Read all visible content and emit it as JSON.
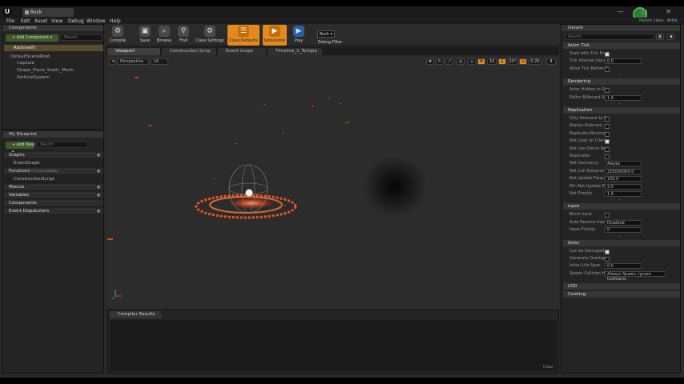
{
  "window": {
    "doc_tab": "Rock",
    "controls": "— ▢ ✕"
  },
  "menu": [
    "File",
    "Edit",
    "Asset",
    "View",
    "Debug",
    "Window",
    "Help"
  ],
  "parent_class": {
    "label": "Parent class:",
    "value": "Actor"
  },
  "components": {
    "title": "Components",
    "add_button": "+ Add Component ▾",
    "search_placeholder": "Search",
    "self_item": "Rock(self)",
    "items": [
      "DefaultSceneRoot",
      "Capsule",
      "Shape_Plane_Static_Mesh",
      "ParticleSystem"
    ]
  },
  "my_blueprint": {
    "title": "My Blueprint",
    "add_new": "+ Add New ▾",
    "search_placeholder": "Search",
    "sections": [
      {
        "label": "Graphs",
        "plus": "+"
      },
      {
        "label": "EventGraph",
        "plus": ""
      },
      {
        "label": "Functions",
        "note": "(4 Overridable)",
        "plus": "+"
      },
      {
        "label": "ConstructionScript",
        "plus": ""
      },
      {
        "label": "Macros",
        "plus": "+"
      },
      {
        "label": "Variables",
        "plus": "+"
      },
      {
        "label": "Components",
        "plus": ""
      },
      {
        "label": "Event Dispatchers",
        "plus": "+"
      }
    ]
  },
  "toolbar": {
    "buttons": [
      "Compile",
      "Save",
      "Browse",
      "Find",
      "Class Settings",
      "Class Defaults",
      "Simulation",
      "Play",
      "Debug Filter"
    ],
    "debug_object": "Rock ▾"
  },
  "doc_tabs": [
    "Viewport",
    "Construction Scrip",
    "Event Graph",
    "Timeline_1_Templa"
  ],
  "viewport": {
    "view_mode": "Perspective",
    "lit_mode": "Lit",
    "grid_snap": "10",
    "rot_snap": "10°",
    "scale_snap": "0.25",
    "cam_speed": "4"
  },
  "compiler": {
    "title": "Compiler Results",
    "clear": "Clear"
  },
  "details": {
    "title": "Details",
    "search_placeholder": "Search",
    "sections": [
      {
        "label": "Actor Tick",
        "props": [
          {
            "name": "Start with Tick Enab",
            "type": "check",
            "on": true
          },
          {
            "name": "Tick Interval (secs)",
            "type": "value",
            "value": "0.0"
          },
          {
            "name": "Allow Tick Before B",
            "type": "check",
            "on": false
          }
        ]
      },
      {
        "label": "Rendering",
        "props": [
          {
            "name": "Actor Hidden In Ga",
            "type": "check",
            "on": false
          },
          {
            "name": "Editor Billboard Sc",
            "type": "value",
            "value": "1.0"
          }
        ]
      },
      {
        "label": "Replication",
        "props": [
          {
            "name": "Only Relevant to O",
            "type": "check",
            "on": false
          },
          {
            "name": "Always Relevant",
            "type": "check",
            "on": false
          },
          {
            "name": "Replicate Moveme",
            "type": "check",
            "on": false
          },
          {
            "name": "Net Load on Client",
            "type": "check",
            "on": true
          },
          {
            "name": "Net Use Owner Rel",
            "type": "check",
            "on": false
          },
          {
            "name": "Replicates",
            "type": "check",
            "on": false
          },
          {
            "name": "Net Dormancy",
            "type": "value",
            "value": "Awake"
          },
          {
            "name": "Net Cull Distance S",
            "type": "value",
            "value": "225000000.0"
          },
          {
            "name": "Net Update Freque",
            "type": "value",
            "value": "100.0"
          },
          {
            "name": "Min Net Update Fr",
            "type": "value",
            "value": "2.0"
          },
          {
            "name": "Net Priority",
            "type": "value",
            "value": "1.0"
          }
        ]
      },
      {
        "label": "Input",
        "props": [
          {
            "name": "Block Input",
            "type": "check",
            "on": false
          },
          {
            "name": "Auto Receive Input",
            "type": "value",
            "value": "Disabled"
          },
          {
            "name": "Input Priority",
            "type": "value",
            "value": "0"
          }
        ]
      },
      {
        "label": "Actor",
        "props": [
          {
            "name": "Can be Damaged",
            "type": "check",
            "on": true
          },
          {
            "name": "Generate Overlap",
            "type": "check",
            "on": false
          },
          {
            "name": "Initial Life Span",
            "type": "value",
            "value": "0.0"
          },
          {
            "name": "Spawn Collision Ha",
            "type": "value",
            "value": "Always Spawn, Ignore Collisions",
            "wide": true
          }
        ]
      },
      {
        "label": "LOD",
        "props": []
      },
      {
        "label": "Cooking",
        "props": []
      }
    ]
  },
  "colors": {
    "accent_orange": "#e28a1e",
    "ring_fire": "#ff5a1e",
    "panel_bg": "#242424"
  }
}
